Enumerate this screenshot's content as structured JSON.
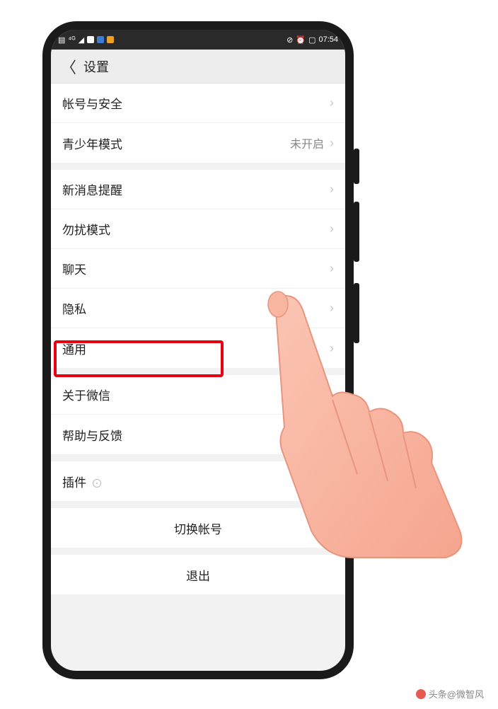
{
  "status": {
    "time": "07:54",
    "left_indicators": [
      "signal",
      "4G",
      "wifi",
      "bt"
    ],
    "right_indicators": [
      "vibrate",
      "alarm",
      "battery"
    ]
  },
  "header": {
    "title": "设置"
  },
  "groups": [
    {
      "rows": [
        {
          "key": "account",
          "label": "帐号与安全",
          "value": ""
        },
        {
          "key": "youth",
          "label": "青少年模式",
          "value": "未开启"
        }
      ]
    },
    {
      "rows": [
        {
          "key": "notifications",
          "label": "新消息提醒",
          "value": ""
        },
        {
          "key": "dnd",
          "label": "勿扰模式",
          "value": ""
        },
        {
          "key": "chat",
          "label": "聊天",
          "value": ""
        },
        {
          "key": "privacy",
          "label": "隐私",
          "value": ""
        },
        {
          "key": "general",
          "label": "通用",
          "value": ""
        }
      ]
    },
    {
      "rows": [
        {
          "key": "about",
          "label": "关于微信",
          "value": ""
        },
        {
          "key": "help",
          "label": "帮助与反馈",
          "value": ""
        }
      ]
    },
    {
      "rows": [
        {
          "key": "plugins",
          "label": "插件",
          "value": "",
          "icon": "pin"
        }
      ]
    }
  ],
  "actions": {
    "switch": "切换帐号",
    "logout": "退出"
  },
  "watermark": {
    "text": "头条@微智风"
  }
}
